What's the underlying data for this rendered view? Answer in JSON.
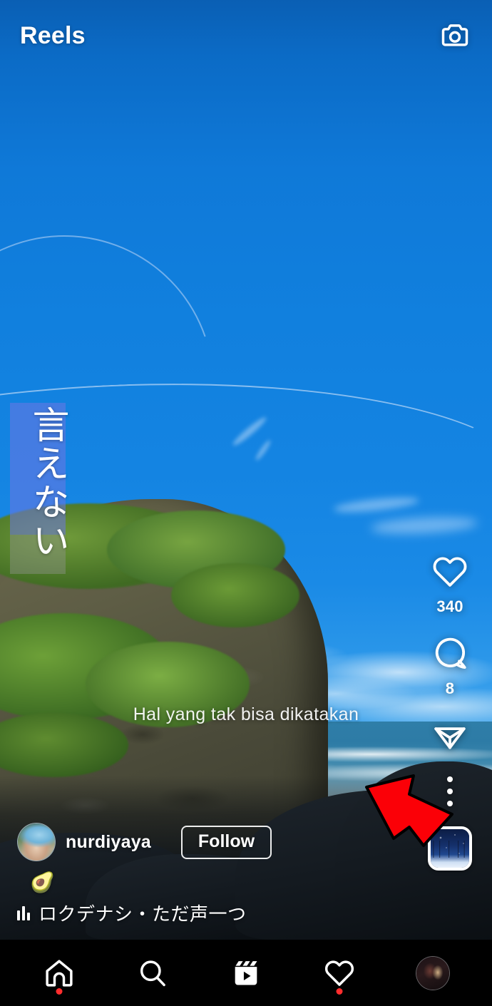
{
  "header": {
    "title": "Reels",
    "camera_icon": "camera-icon"
  },
  "video": {
    "overlay_vertical_text": "言えない",
    "subtitle": "Hal yang tak bisa dikatakan",
    "scene_description": "coastal cliff with green vegetation, blue sky, ocean and beach"
  },
  "actions": {
    "like": {
      "icon": "heart-icon",
      "count": "340"
    },
    "comment": {
      "icon": "comment-icon",
      "count": "8"
    },
    "share": {
      "icon": "share-paper-plane-icon"
    },
    "more": {
      "icon": "three-dots-vertical-icon"
    },
    "audio_thumbnail": {
      "icon": "audio-album-art"
    }
  },
  "annotation": {
    "arrow": {
      "name": "red-arrow-pointing-to-more-menu",
      "fill": "#fb0007",
      "stroke": "#000000"
    }
  },
  "meta": {
    "username": "nurdiyaya",
    "follow_label": "Follow",
    "caption_emoji": "🥑",
    "audio_title": "ロクデナシ・ただ声一つ",
    "audio_icon": "music-bars-icon"
  },
  "bottom_nav": {
    "items": [
      {
        "name": "home",
        "icon": "home-icon",
        "badge": true
      },
      {
        "name": "search",
        "icon": "search-icon",
        "badge": false
      },
      {
        "name": "reels",
        "icon": "reels-icon",
        "badge": false
      },
      {
        "name": "activity",
        "icon": "heart-icon",
        "badge": true
      },
      {
        "name": "profile",
        "icon": "profile-avatar",
        "badge": false
      }
    ]
  },
  "colors": {
    "accent_red": "#fb0007",
    "badge_red": "#ff2d2d",
    "sky_blue": "#1180de",
    "nav_background": "#000000",
    "text_white": "#ffffff"
  }
}
